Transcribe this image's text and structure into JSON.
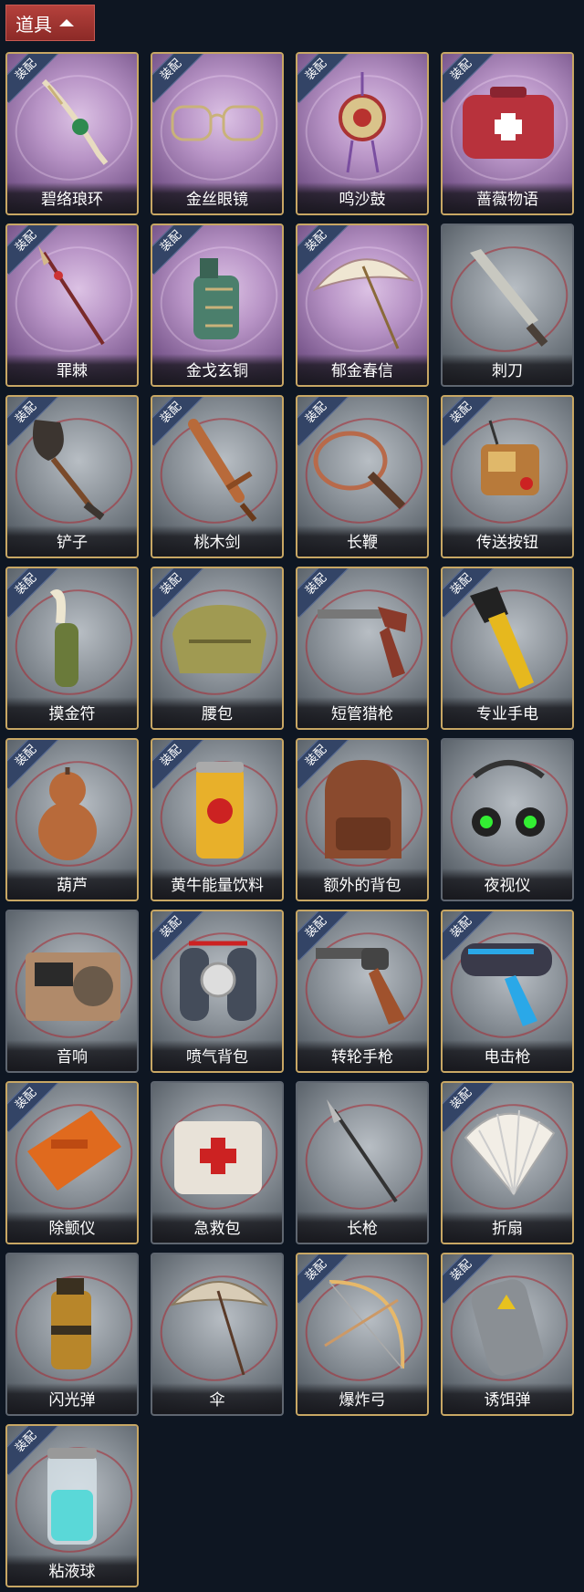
{
  "header": {
    "title": "道具"
  },
  "badge_text": "装配",
  "items": [
    {
      "name": "碧络琅环",
      "equipped": true,
      "frame": "gold",
      "bg": "purple",
      "icon": "jade-bracelet-icon"
    },
    {
      "name": "金丝眼镜",
      "equipped": true,
      "frame": "gold",
      "bg": "purple",
      "icon": "glasses-icon"
    },
    {
      "name": "鸣沙鼓",
      "equipped": true,
      "frame": "gold",
      "bg": "purple",
      "icon": "sand-drum-icon"
    },
    {
      "name": "蔷薇物语",
      "equipped": true,
      "frame": "gold",
      "bg": "purple",
      "icon": "red-case-icon"
    },
    {
      "name": "罪棘",
      "equipped": true,
      "frame": "gold",
      "bg": "purple",
      "icon": "spear-icon"
    },
    {
      "name": "金戈玄铜",
      "equipped": true,
      "frame": "gold",
      "bg": "purple",
      "icon": "bronze-grenade-icon"
    },
    {
      "name": "郁金春信",
      "equipped": true,
      "frame": "gold",
      "bg": "purple",
      "icon": "parasol-icon"
    },
    {
      "name": "刺刀",
      "equipped": false,
      "frame": "plain",
      "bg": "grey",
      "icon": "knife-icon"
    },
    {
      "name": "铲子",
      "equipped": true,
      "frame": "gold",
      "bg": "grey",
      "icon": "shovel-icon"
    },
    {
      "name": "桃木剑",
      "equipped": true,
      "frame": "gold",
      "bg": "grey",
      "icon": "wooden-sword-icon"
    },
    {
      "name": "长鞭",
      "equipped": true,
      "frame": "gold",
      "bg": "grey",
      "icon": "whip-icon"
    },
    {
      "name": "传送按钮",
      "equipped": true,
      "frame": "gold",
      "bg": "grey",
      "icon": "remote-button-icon"
    },
    {
      "name": "摸金符",
      "equipped": true,
      "frame": "gold",
      "bg": "grey",
      "icon": "talisman-icon"
    },
    {
      "name": "腰包",
      "equipped": true,
      "frame": "gold",
      "bg": "grey",
      "icon": "waist-bag-icon"
    },
    {
      "name": "短管猎枪",
      "equipped": true,
      "frame": "gold",
      "bg": "grey",
      "icon": "shotgun-icon"
    },
    {
      "name": "专业手电",
      "equipped": true,
      "frame": "gold",
      "bg": "grey",
      "icon": "flashlight-icon"
    },
    {
      "name": "葫芦",
      "equipped": true,
      "frame": "gold",
      "bg": "grey",
      "icon": "gourd-icon"
    },
    {
      "name": "黄牛能量饮料",
      "equipped": true,
      "frame": "gold",
      "bg": "grey",
      "icon": "energy-drink-icon"
    },
    {
      "name": "额外的背包",
      "equipped": true,
      "frame": "gold",
      "bg": "grey",
      "icon": "backpack-icon"
    },
    {
      "name": "夜视仪",
      "equipped": false,
      "frame": "plain",
      "bg": "grey",
      "icon": "night-vision-icon"
    },
    {
      "name": "音响",
      "equipped": false,
      "frame": "plain",
      "bg": "grey",
      "icon": "radio-icon"
    },
    {
      "name": "喷气背包",
      "equipped": true,
      "frame": "gold",
      "bg": "grey",
      "icon": "jetpack-icon"
    },
    {
      "name": "转轮手枪",
      "equipped": true,
      "frame": "gold",
      "bg": "grey",
      "icon": "revolver-icon"
    },
    {
      "name": "电击枪",
      "equipped": true,
      "frame": "gold",
      "bg": "grey",
      "icon": "taser-icon"
    },
    {
      "name": "除颤仪",
      "equipped": true,
      "frame": "gold",
      "bg": "grey",
      "icon": "defibrillator-icon"
    },
    {
      "name": "急救包",
      "equipped": false,
      "frame": "plain",
      "bg": "grey",
      "icon": "first-aid-kit-icon"
    },
    {
      "name": "长枪",
      "equipped": false,
      "frame": "plain",
      "bg": "grey",
      "icon": "long-spear-icon"
    },
    {
      "name": "折扇",
      "equipped": true,
      "frame": "gold",
      "bg": "grey",
      "icon": "folding-fan-icon"
    },
    {
      "name": "闪光弹",
      "equipped": false,
      "frame": "plain",
      "bg": "grey",
      "icon": "flashbang-icon"
    },
    {
      "name": "伞",
      "equipped": false,
      "frame": "plain",
      "bg": "grey",
      "icon": "umbrella-icon"
    },
    {
      "name": "爆炸弓",
      "equipped": true,
      "frame": "gold",
      "bg": "grey",
      "icon": "bow-icon"
    },
    {
      "name": "诱饵弹",
      "equipped": true,
      "frame": "gold",
      "bg": "grey",
      "icon": "decoy-canister-icon"
    },
    {
      "name": "粘液球",
      "equipped": true,
      "frame": "gold",
      "bg": "grey",
      "icon": "slime-vial-icon"
    }
  ]
}
